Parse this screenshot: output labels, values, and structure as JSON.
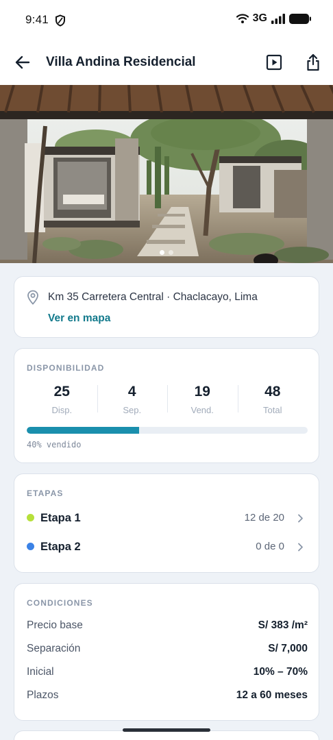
{
  "status_bar": {
    "time": "9:41",
    "network": "3G",
    "icons": [
      "shield-icon",
      "wifi-icon",
      "signal-icon",
      "battery-icon"
    ]
  },
  "app_bar": {
    "title": "Villa Andina Residencial",
    "icons": [
      "back-arrow-icon",
      "play-icon",
      "share-icon"
    ]
  },
  "gallery": {
    "slides": 2,
    "active_slide": 1
  },
  "location": {
    "address": "Km 35 Carretera Central · Chaclacayo, Lima",
    "map_link": "Ver en mapa"
  },
  "availability": {
    "section_label": "DISPONIBILIDAD",
    "stats": [
      {
        "value": "25",
        "label": "Disp."
      },
      {
        "value": "4",
        "label": "Sep."
      },
      {
        "value": "19",
        "label": "Vend."
      },
      {
        "value": "48",
        "label": "Total"
      }
    ],
    "progress_fraction": 0.4,
    "progress_text": "40% vendido",
    "progress_color": "#1a8fad"
  },
  "stages": {
    "section_label": "ETAPAS",
    "items": [
      {
        "name": "Etapa 1",
        "count": "12 de 20",
        "color": "#b6e03a"
      },
      {
        "name": "Etapa 2",
        "count": "0 de 0",
        "color": "#3b82e6"
      }
    ]
  },
  "conditions": {
    "section_label": "CONDICIONES",
    "rows": [
      {
        "label": "Precio base",
        "value": "S/ 383 /m²"
      },
      {
        "label": "Separación",
        "value": "S/ 7,000"
      },
      {
        "label": "Inicial",
        "value": "10% – 70%"
      },
      {
        "label": "Plazos",
        "value": "12 a 60 meses"
      }
    ]
  },
  "colors": {
    "accent": "#137a8c",
    "background": "#eef2f7"
  }
}
